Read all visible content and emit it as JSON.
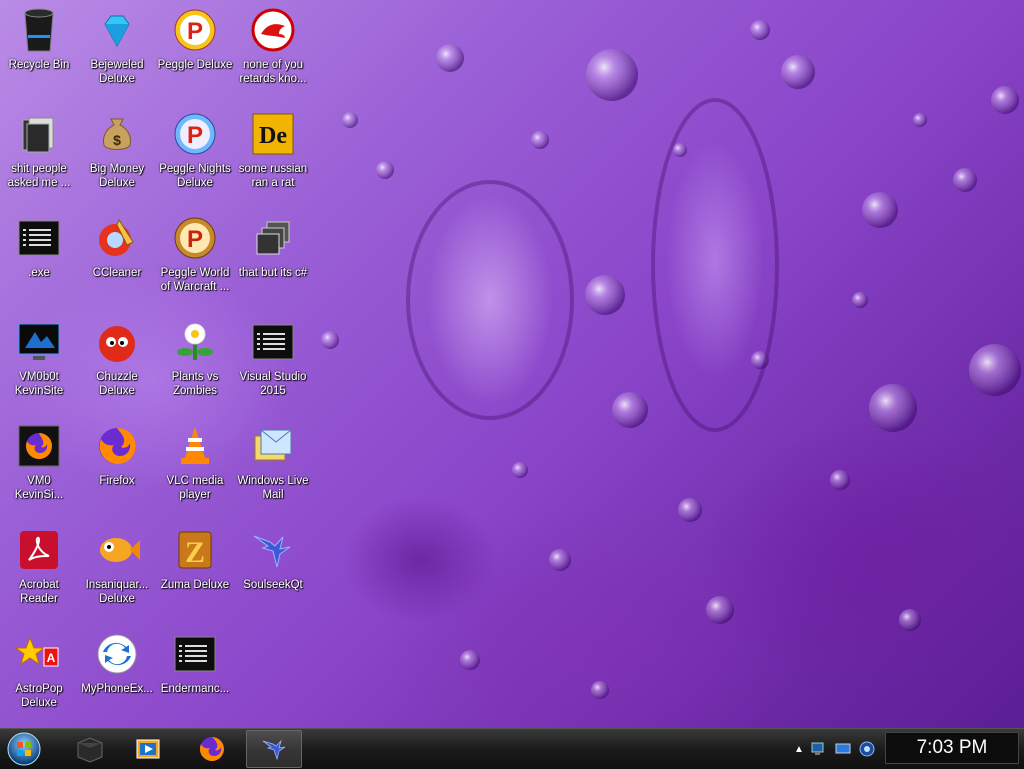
{
  "desktop": {
    "icons": [
      {
        "label": "Recycle Bin",
        "icon": "recycle-bin-icon"
      },
      {
        "label": "Bejeweled\nDeluxe",
        "icon": "diamond-icon"
      },
      {
        "label": "Peggle Deluxe",
        "icon": "peggle-icon"
      },
      {
        "label": "none of you\nretards kno...",
        "icon": "dragon-badge-icon"
      },
      {
        "label": "shit people\nasked me ...",
        "icon": "folder-icon"
      },
      {
        "label": "Big Money\nDeluxe",
        "icon": "money-bag-icon"
      },
      {
        "label": "Peggle Nights\nDeluxe",
        "icon": "peggle-nights-icon"
      },
      {
        "label": "some russian\nran a rat",
        "icon": "de-icon"
      },
      {
        "label": ".exe",
        "icon": "app-window-icon"
      },
      {
        "label": "CCleaner",
        "icon": "ccleaner-icon"
      },
      {
        "label": "Peggle World\nof Warcraft ...",
        "icon": "peggle-wow-icon"
      },
      {
        "label": "that but its c#",
        "icon": "stacked-windows-icon"
      },
      {
        "label": "VM0b0t\nKevinSite",
        "icon": "monitor-app-icon"
      },
      {
        "label": "Chuzzle\nDeluxe",
        "icon": "chuzzle-icon"
      },
      {
        "label": "Plants vs\nZombies",
        "icon": "plants-zombies-icon"
      },
      {
        "label": "Visual Studio\n2015",
        "icon": "app-window-icon"
      },
      {
        "label": "VM0\nKevinSi...",
        "icon": "firefox-shortcut-icon"
      },
      {
        "label": "Firefox",
        "icon": "firefox-icon"
      },
      {
        "label": "VLC media\nplayer",
        "icon": "vlc-cone-icon"
      },
      {
        "label": "Windows Live\nMail",
        "icon": "mail-icon"
      },
      {
        "label": "Acrobat\nReader",
        "icon": "acrobat-icon"
      },
      {
        "label": "Insaniquar...\nDeluxe",
        "icon": "fish-icon"
      },
      {
        "label": "Zuma Deluxe",
        "icon": "zuma-icon"
      },
      {
        "label": "SoulseekQt",
        "icon": "bird-icon"
      },
      {
        "label": "AstroPop\nDeluxe",
        "icon": "astropop-icon"
      },
      {
        "label": "MyPhoneEx...",
        "icon": "sync-arrows-icon"
      },
      {
        "label": "Endermanc...",
        "icon": "app-window-icon"
      }
    ]
  },
  "taskbar": {
    "start_icon": "windows-orb-icon",
    "pinned": [
      {
        "icon": "dark-box-icon"
      },
      {
        "icon": "media-player-icon"
      },
      {
        "icon": "firefox-icon"
      },
      {
        "icon": "bird-icon"
      }
    ],
    "tray": {
      "overflow_symbol": "▲",
      "icons": [
        "network-icon",
        "display-icon",
        "shield-icon"
      ]
    },
    "clock": "7:03 PM"
  }
}
